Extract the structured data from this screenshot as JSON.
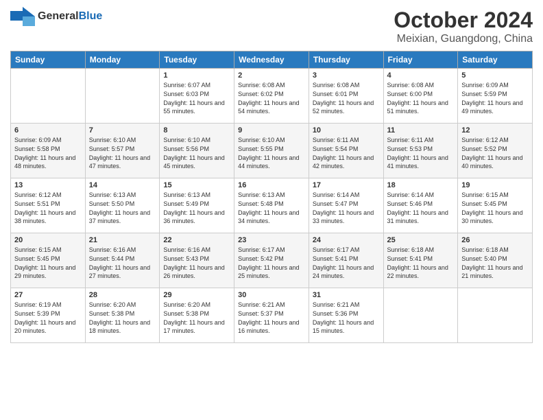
{
  "logo": {
    "general": "General",
    "blue": "Blue"
  },
  "title": "October 2024",
  "location": "Meixian, Guangdong, China",
  "days_of_week": [
    "Sunday",
    "Monday",
    "Tuesday",
    "Wednesday",
    "Thursday",
    "Friday",
    "Saturday"
  ],
  "weeks": [
    [
      {
        "day": "",
        "sunrise": "",
        "sunset": "",
        "daylight": ""
      },
      {
        "day": "",
        "sunrise": "",
        "sunset": "",
        "daylight": ""
      },
      {
        "day": "1",
        "sunrise": "Sunrise: 6:07 AM",
        "sunset": "Sunset: 6:03 PM",
        "daylight": "Daylight: 11 hours and 55 minutes."
      },
      {
        "day": "2",
        "sunrise": "Sunrise: 6:08 AM",
        "sunset": "Sunset: 6:02 PM",
        "daylight": "Daylight: 11 hours and 54 minutes."
      },
      {
        "day": "3",
        "sunrise": "Sunrise: 6:08 AM",
        "sunset": "Sunset: 6:01 PM",
        "daylight": "Daylight: 11 hours and 52 minutes."
      },
      {
        "day": "4",
        "sunrise": "Sunrise: 6:08 AM",
        "sunset": "Sunset: 6:00 PM",
        "daylight": "Daylight: 11 hours and 51 minutes."
      },
      {
        "day": "5",
        "sunrise": "Sunrise: 6:09 AM",
        "sunset": "Sunset: 5:59 PM",
        "daylight": "Daylight: 11 hours and 49 minutes."
      }
    ],
    [
      {
        "day": "6",
        "sunrise": "Sunrise: 6:09 AM",
        "sunset": "Sunset: 5:58 PM",
        "daylight": "Daylight: 11 hours and 48 minutes."
      },
      {
        "day": "7",
        "sunrise": "Sunrise: 6:10 AM",
        "sunset": "Sunset: 5:57 PM",
        "daylight": "Daylight: 11 hours and 47 minutes."
      },
      {
        "day": "8",
        "sunrise": "Sunrise: 6:10 AM",
        "sunset": "Sunset: 5:56 PM",
        "daylight": "Daylight: 11 hours and 45 minutes."
      },
      {
        "day": "9",
        "sunrise": "Sunrise: 6:10 AM",
        "sunset": "Sunset: 5:55 PM",
        "daylight": "Daylight: 11 hours and 44 minutes."
      },
      {
        "day": "10",
        "sunrise": "Sunrise: 6:11 AM",
        "sunset": "Sunset: 5:54 PM",
        "daylight": "Daylight: 11 hours and 42 minutes."
      },
      {
        "day": "11",
        "sunrise": "Sunrise: 6:11 AM",
        "sunset": "Sunset: 5:53 PM",
        "daylight": "Daylight: 11 hours and 41 minutes."
      },
      {
        "day": "12",
        "sunrise": "Sunrise: 6:12 AM",
        "sunset": "Sunset: 5:52 PM",
        "daylight": "Daylight: 11 hours and 40 minutes."
      }
    ],
    [
      {
        "day": "13",
        "sunrise": "Sunrise: 6:12 AM",
        "sunset": "Sunset: 5:51 PM",
        "daylight": "Daylight: 11 hours and 38 minutes."
      },
      {
        "day": "14",
        "sunrise": "Sunrise: 6:13 AM",
        "sunset": "Sunset: 5:50 PM",
        "daylight": "Daylight: 11 hours and 37 minutes."
      },
      {
        "day": "15",
        "sunrise": "Sunrise: 6:13 AM",
        "sunset": "Sunset: 5:49 PM",
        "daylight": "Daylight: 11 hours and 36 minutes."
      },
      {
        "day": "16",
        "sunrise": "Sunrise: 6:13 AM",
        "sunset": "Sunset: 5:48 PM",
        "daylight": "Daylight: 11 hours and 34 minutes."
      },
      {
        "day": "17",
        "sunrise": "Sunrise: 6:14 AM",
        "sunset": "Sunset: 5:47 PM",
        "daylight": "Daylight: 11 hours and 33 minutes."
      },
      {
        "day": "18",
        "sunrise": "Sunrise: 6:14 AM",
        "sunset": "Sunset: 5:46 PM",
        "daylight": "Daylight: 11 hours and 31 minutes."
      },
      {
        "day": "19",
        "sunrise": "Sunrise: 6:15 AM",
        "sunset": "Sunset: 5:45 PM",
        "daylight": "Daylight: 11 hours and 30 minutes."
      }
    ],
    [
      {
        "day": "20",
        "sunrise": "Sunrise: 6:15 AM",
        "sunset": "Sunset: 5:45 PM",
        "daylight": "Daylight: 11 hours and 29 minutes."
      },
      {
        "day": "21",
        "sunrise": "Sunrise: 6:16 AM",
        "sunset": "Sunset: 5:44 PM",
        "daylight": "Daylight: 11 hours and 27 minutes."
      },
      {
        "day": "22",
        "sunrise": "Sunrise: 6:16 AM",
        "sunset": "Sunset: 5:43 PM",
        "daylight": "Daylight: 11 hours and 26 minutes."
      },
      {
        "day": "23",
        "sunrise": "Sunrise: 6:17 AM",
        "sunset": "Sunset: 5:42 PM",
        "daylight": "Daylight: 11 hours and 25 minutes."
      },
      {
        "day": "24",
        "sunrise": "Sunrise: 6:17 AM",
        "sunset": "Sunset: 5:41 PM",
        "daylight": "Daylight: 11 hours and 24 minutes."
      },
      {
        "day": "25",
        "sunrise": "Sunrise: 6:18 AM",
        "sunset": "Sunset: 5:41 PM",
        "daylight": "Daylight: 11 hours and 22 minutes."
      },
      {
        "day": "26",
        "sunrise": "Sunrise: 6:18 AM",
        "sunset": "Sunset: 5:40 PM",
        "daylight": "Daylight: 11 hours and 21 minutes."
      }
    ],
    [
      {
        "day": "27",
        "sunrise": "Sunrise: 6:19 AM",
        "sunset": "Sunset: 5:39 PM",
        "daylight": "Daylight: 11 hours and 20 minutes."
      },
      {
        "day": "28",
        "sunrise": "Sunrise: 6:20 AM",
        "sunset": "Sunset: 5:38 PM",
        "daylight": "Daylight: 11 hours and 18 minutes."
      },
      {
        "day": "29",
        "sunrise": "Sunrise: 6:20 AM",
        "sunset": "Sunset: 5:38 PM",
        "daylight": "Daylight: 11 hours and 17 minutes."
      },
      {
        "day": "30",
        "sunrise": "Sunrise: 6:21 AM",
        "sunset": "Sunset: 5:37 PM",
        "daylight": "Daylight: 11 hours and 16 minutes."
      },
      {
        "day": "31",
        "sunrise": "Sunrise: 6:21 AM",
        "sunset": "Sunset: 5:36 PM",
        "daylight": "Daylight: 11 hours and 15 minutes."
      },
      {
        "day": "",
        "sunrise": "",
        "sunset": "",
        "daylight": ""
      },
      {
        "day": "",
        "sunrise": "",
        "sunset": "",
        "daylight": ""
      }
    ]
  ]
}
